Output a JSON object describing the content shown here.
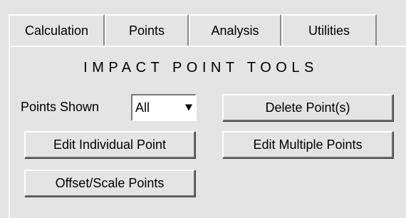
{
  "tabs": [
    {
      "label": "Calculation"
    },
    {
      "label": "Points"
    },
    {
      "label": "Analysis"
    },
    {
      "label": "Utilities"
    }
  ],
  "panel": {
    "title": "IMPACT POINT TOOLS",
    "points_shown_label": "Points Shown",
    "points_shown_value": "All",
    "delete_button": "Delete Point(s)",
    "edit_individual_button": "Edit Individual Point",
    "edit_multiple_button": "Edit Multiple Points",
    "offset_scale_button": "Offset/Scale Points"
  },
  "colors": {
    "panel_bg": "#e4e4e4",
    "highlight": "#ffffff",
    "shadow": "#6f6f6f"
  }
}
